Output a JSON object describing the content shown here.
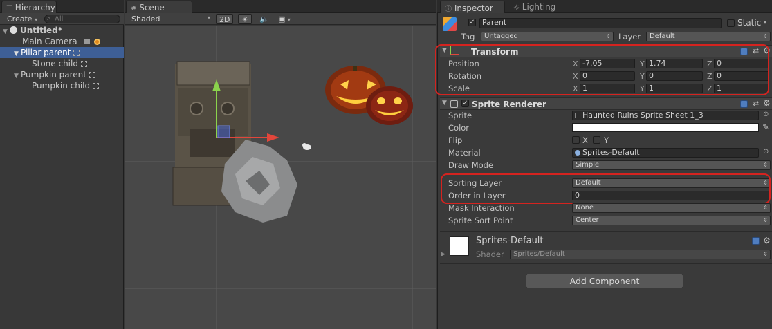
{
  "hierarchy": {
    "tab": "Hierarchy",
    "create": "Create",
    "search_placeholder": "All",
    "scene": "Untitled*",
    "items": [
      {
        "label": "Main Camera"
      },
      {
        "label": "Pillar parent"
      },
      {
        "label": "Stone child"
      },
      {
        "label": "Pumpkin parent"
      },
      {
        "label": "Pumpkin child"
      }
    ]
  },
  "scene_view": {
    "tab": "Scene",
    "shading": "Shaded",
    "mode_2d": "2D"
  },
  "inspector": {
    "tab": "Inspector",
    "tab2": "Lighting",
    "object_name": "Parent",
    "static_label": "Static",
    "tag_label": "Tag",
    "tag_value": "Untagged",
    "layer_label": "Layer",
    "layer_value": "Default",
    "transform": {
      "title": "Transform",
      "position_label": "Position",
      "rotation_label": "Rotation",
      "scale_label": "Scale",
      "axis_x": "X",
      "axis_y": "Y",
      "axis_z": "Z",
      "position": {
        "x": "-7.05",
        "y": "1.74",
        "z": "0"
      },
      "rotation": {
        "x": "0",
        "y": "0",
        "z": "0"
      },
      "scale": {
        "x": "1",
        "y": "1",
        "z": "1"
      }
    },
    "sprite_renderer": {
      "title": "Sprite Renderer",
      "sprite_label": "Sprite",
      "sprite_value": "Haunted Ruins Sprite Sheet 1_3",
      "color_label": "Color",
      "flip_label": "Flip",
      "flip_x": "X",
      "flip_y": "Y",
      "material_label": "Material",
      "material_value": "Sprites-Default",
      "draw_mode_label": "Draw Mode",
      "draw_mode_value": "Simple",
      "sorting_layer_label": "Sorting Layer",
      "sorting_layer_value": "Default",
      "order_label": "Order in Layer",
      "order_value": "0",
      "mask_label": "Mask Interaction",
      "mask_value": "None",
      "sort_point_label": "Sprite Sort Point",
      "sort_point_value": "Center"
    },
    "material": {
      "name": "Sprites-Default",
      "shader_label": "Shader",
      "shader_value": "Sprites/Default"
    },
    "add_component": "Add Component"
  }
}
